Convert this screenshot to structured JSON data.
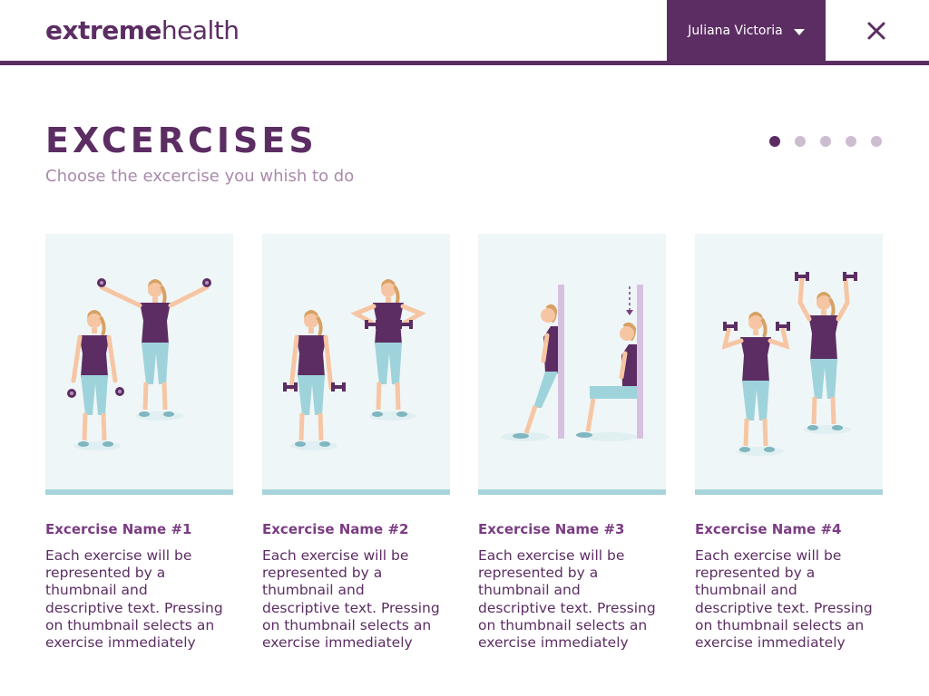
{
  "header": {
    "logo_bold": "extreme",
    "logo_light": "health",
    "user_name": "Juliana Victoria"
  },
  "page": {
    "title": "EXCERCISES",
    "subtitle": "Choose the excercise you whish to do"
  },
  "pager": {
    "pages": 5,
    "active_index": 0
  },
  "exercises": [
    {
      "title": "Excercise Name #1",
      "description": "Each exercise will be represented by a thumbnail and descriptive text. Pressing on thumbnail selects an exercise  immediately"
    },
    {
      "title": "Excercise Name #2",
      "description": "Each exercise will be represented by a thumbnail and descriptive text. Pressing on thumbnail selects an exercise  immediately"
    },
    {
      "title": "Excercise Name #3",
      "description": "Each exercise will be represented by a thumbnail and descriptive text. Pressing on thumbnail selects an exercise  immediately"
    },
    {
      "title": "Excercise Name #4",
      "description": "Each exercise will be represented by a thumbnail and descriptive text. Pressing on thumbnail selects an exercise  immediately"
    }
  ],
  "icons": {
    "close": "close-icon",
    "dropdown": "chevron-down-icon"
  },
  "colors": {
    "brand": "#5c2d63",
    "accent_light": "#a6d4da",
    "thumb_bg": "#eff6f7",
    "skin": "#f6c6a4",
    "hair": "#d7a165",
    "pants": "#9fd3dc"
  }
}
